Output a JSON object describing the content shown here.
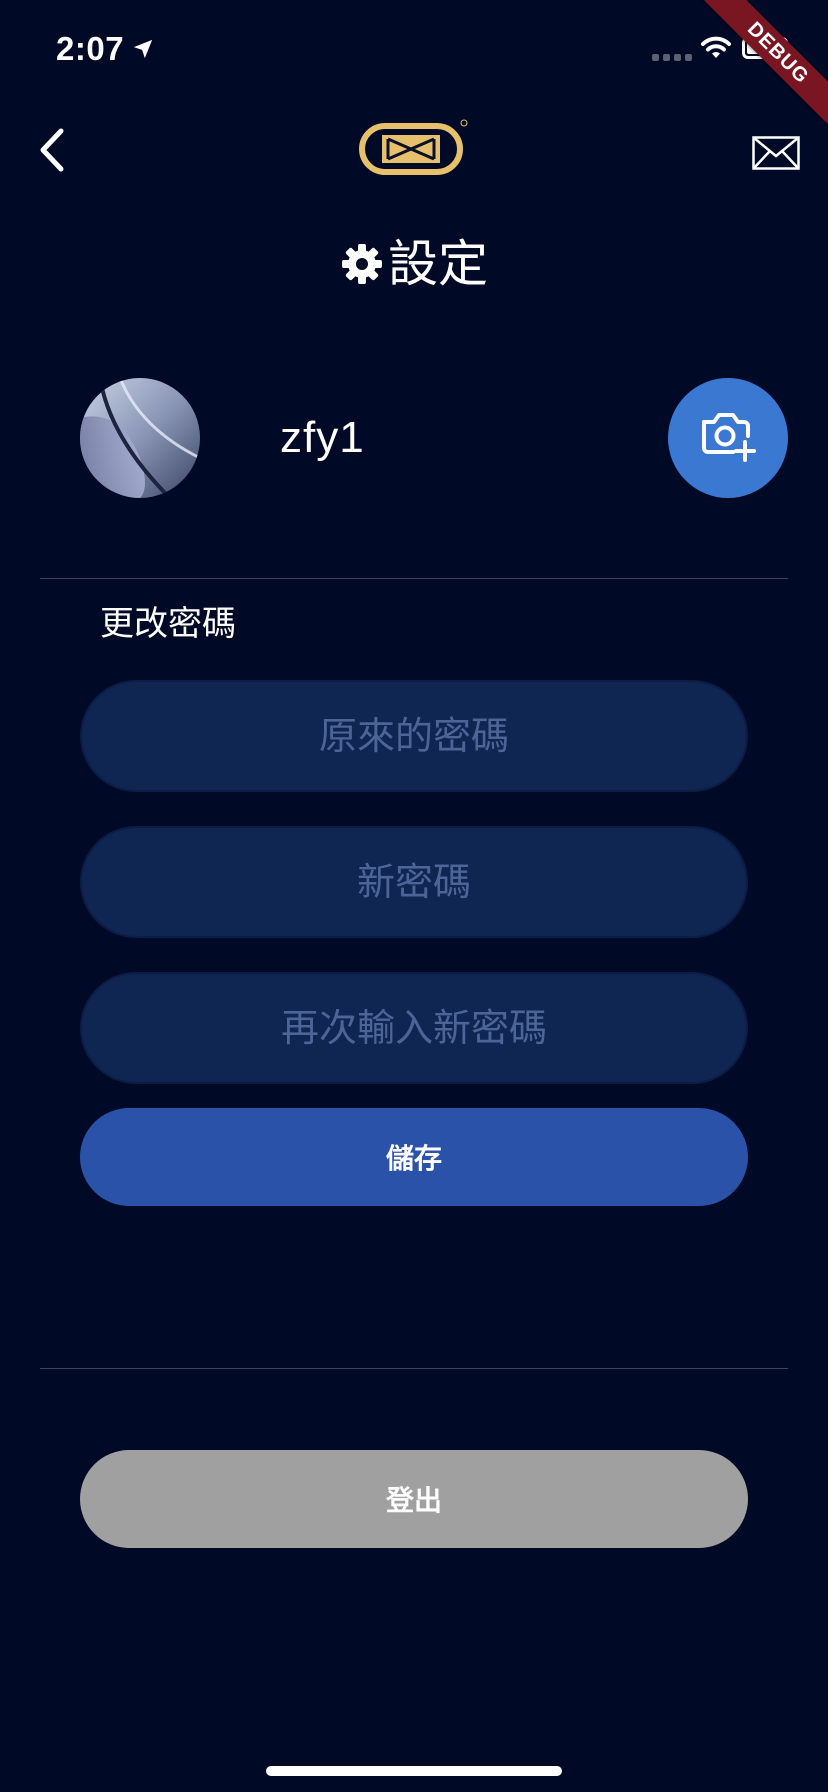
{
  "status_bar": {
    "time": "2:07",
    "icons": [
      "location-arrow-icon",
      "signal-icon",
      "wifi-icon",
      "battery-icon"
    ]
  },
  "debug_banner": "DEBUG",
  "nav": {
    "back_icon": "chevron-left-icon",
    "logo_icon": "brand-logo",
    "mail_icon": "envelope-icon"
  },
  "title": {
    "icon": "gear-icon",
    "text": "設定"
  },
  "profile": {
    "username": "zfy1",
    "camera_icon": "camera-plus-icon"
  },
  "change_password": {
    "heading": "更改密碼",
    "fields": {
      "old_placeholder": "原來的密碼",
      "new_placeholder": "新密碼",
      "confirm_placeholder": "再次輸入新密碼"
    },
    "save_label": "儲存"
  },
  "logout_label": "登出",
  "colors": {
    "background": "#000a26",
    "field_bg": "#0f2552",
    "placeholder": "#4d6496",
    "save_button": "#2a52a8",
    "camera_button": "#3b78d2",
    "logout_button": "#a0a0a0",
    "logo_gold": "#e6c06a",
    "debug_ribbon": "#7a1622"
  }
}
